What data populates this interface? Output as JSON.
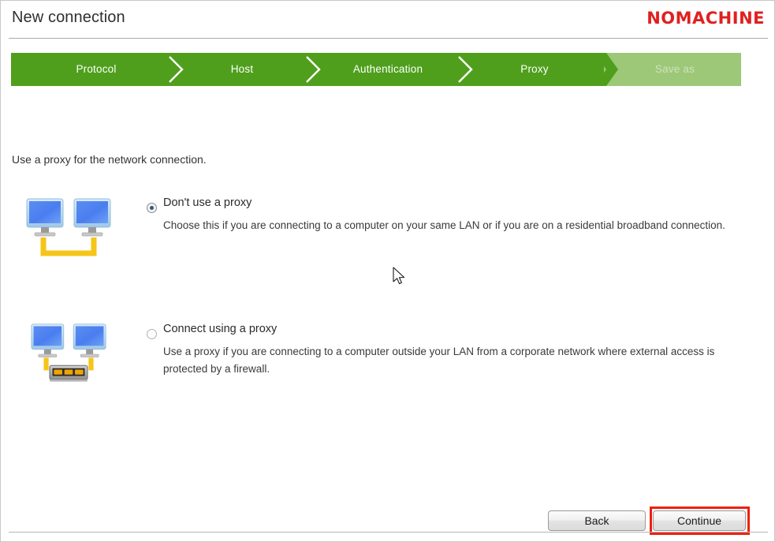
{
  "window": {
    "title": "New connection",
    "brand": "NOMACHINE",
    "brand_color": "#e02020"
  },
  "steps": {
    "accent_done_color": "#4f9f1c",
    "accent_todo_color": "#9cc878",
    "items": [
      {
        "label": "Protocol",
        "state": "done"
      },
      {
        "label": "Host",
        "state": "done"
      },
      {
        "label": "Authentication",
        "state": "done"
      },
      {
        "label": "Proxy",
        "state": "current"
      },
      {
        "label": "Save as",
        "state": "todo"
      }
    ]
  },
  "main": {
    "instruction": "Use a proxy for the network connection.",
    "options": [
      {
        "title": "Don't use a proxy",
        "description": "Choose this if you are connecting to a computer on your same LAN or if you are on a residential broadband connection.",
        "selected": true,
        "icon": "two-computers-lan-icon"
      },
      {
        "title": "Connect using a proxy",
        "description": "Use a proxy if you are connecting to a computer outside your LAN from a corporate network where external access is protected by a firewall.",
        "selected": false,
        "icon": "two-computers-router-icon"
      }
    ]
  },
  "footer": {
    "back_label": "Back",
    "continue_label": "Continue",
    "highlight_color": "#ee2010"
  }
}
